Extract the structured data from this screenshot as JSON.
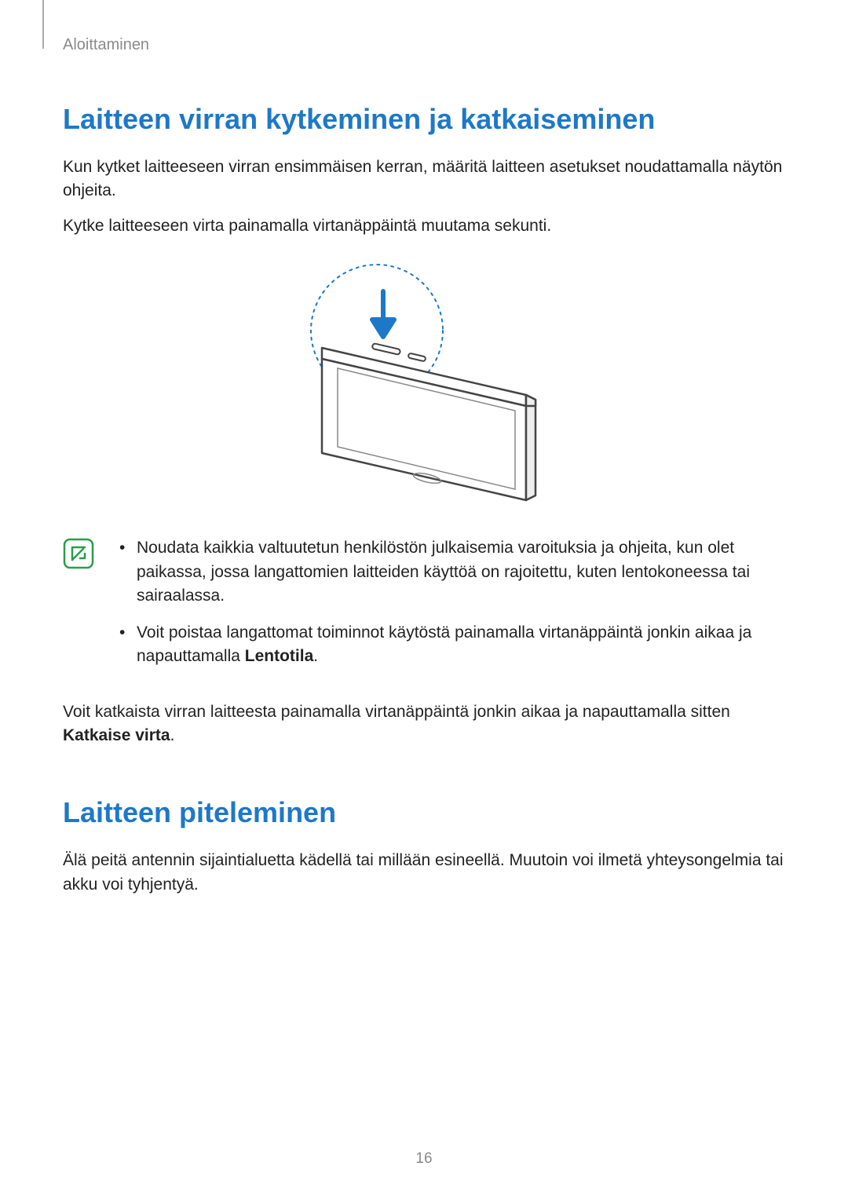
{
  "chapter": "Aloittaminen",
  "section1": {
    "heading": "Laitteen virran kytkeminen ja katkaiseminen",
    "para1": "Kun kytket laitteeseen virran ensimmäisen kerran, määritä laitteen asetukset noudattamalla näytön ohjeita.",
    "para2": "Kytke laitteeseen virta painamalla virtanäppäintä muutama sekunti.",
    "note1": "Noudata kaikkia valtuutetun henkilöstön julkaisemia varoituksia ja ohjeita, kun olet paikassa, jossa langattomien laitteiden käyttöä on rajoitettu, kuten lentokoneessa tai sairaalassa.",
    "note2_a": "Voit poistaa langattomat toiminnot käytöstä painamalla virtanäppäintä jonkin aikaa ja napauttamalla ",
    "note2_b": "Lentotila",
    "note2_c": ".",
    "para3_a": "Voit katkaista virran laitteesta painamalla virtanäppäintä jonkin aikaa ja napauttamalla sitten ",
    "para3_b": "Katkaise virta",
    "para3_c": "."
  },
  "section2": {
    "heading": "Laitteen piteleminen",
    "para1": "Älä peitä antennin sijaintialuetta kädellä tai millään esineellä. Muutoin voi ilmetä yhteysongelmia tai akku voi tyhjentyä."
  },
  "page_number": "16"
}
